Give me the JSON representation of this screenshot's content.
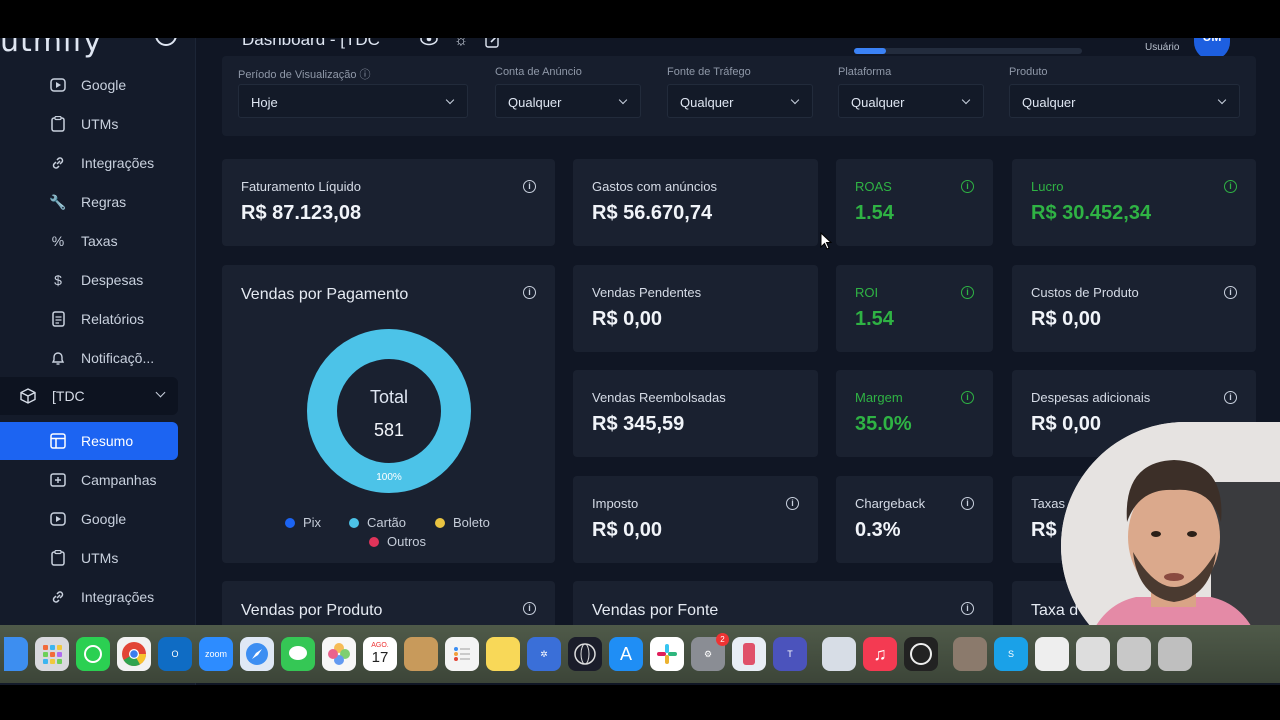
{
  "brand": {
    "name": "utmify"
  },
  "header": {
    "title": "Dashboard - [TDC",
    "progress": 0.14,
    "user_label": "Usuário",
    "avatar_initials": "UM"
  },
  "sidebar": {
    "top_items": [
      {
        "label": "Google",
        "icon": "youtube-icon"
      },
      {
        "label": "UTMs",
        "icon": "clipboard-icon"
      },
      {
        "label": "Integrações",
        "icon": "link-icon"
      },
      {
        "label": "Regras",
        "icon": "wrench-icon"
      },
      {
        "label": "Taxas",
        "icon": "percent-icon"
      },
      {
        "label": "Despesas",
        "icon": "dollar-icon"
      },
      {
        "label": "Relatórios",
        "icon": "report-icon"
      },
      {
        "label": "Notificaçõ...",
        "icon": "bell-icon"
      }
    ],
    "group": {
      "label": "[TDC",
      "icon": "box-icon"
    },
    "group_items": [
      {
        "label": "Resumo",
        "icon": "layout-icon",
        "active": true
      },
      {
        "label": "Campanhas",
        "icon": "campaign-icon"
      },
      {
        "label": "Google",
        "icon": "youtube-icon"
      },
      {
        "label": "UTMs",
        "icon": "clipboard-icon"
      },
      {
        "label": "Integrações",
        "icon": "link-icon"
      }
    ]
  },
  "filters": [
    {
      "label": "Período de Visualização",
      "value": "Hoje"
    },
    {
      "label": "Conta de Anúncio",
      "value": "Qualquer"
    },
    {
      "label": "Fonte de Tráfego",
      "value": "Qualquer"
    },
    {
      "label": "Plataforma",
      "value": "Qualquer"
    },
    {
      "label": "Produto",
      "value": "Qualquer"
    }
  ],
  "cards": {
    "faturamento": {
      "label": "Faturamento Líquido",
      "value": "R$ 87.123,08"
    },
    "gastos": {
      "label": "Gastos com anúncios",
      "value": "R$ 56.670,74"
    },
    "roas": {
      "label": "ROAS",
      "value": "1.54"
    },
    "lucro": {
      "label": "Lucro",
      "value": "R$ 30.452,34"
    },
    "pendentes": {
      "label": "Vendas Pendentes",
      "value": "R$ 0,00"
    },
    "roi": {
      "label": "ROI",
      "value": "1.54"
    },
    "custos": {
      "label": "Custos de Produto",
      "value": "R$ 0,00"
    },
    "reembolsadas": {
      "label": "Vendas Reembolsadas",
      "value": "R$ 345,59"
    },
    "margem": {
      "label": "Margem",
      "value": "35.0%"
    },
    "despesas": {
      "label": "Despesas adicionais",
      "value": "R$ 0,00"
    },
    "imposto": {
      "label": "Imposto",
      "value": "R$ 0,00"
    },
    "chargeback": {
      "label": "Chargeback",
      "value": "0.3%"
    },
    "taxas": {
      "label": "Taxas",
      "value": "R$"
    }
  },
  "payment_chart": {
    "title": "Vendas por Pagamento",
    "center_label": "Total",
    "center_value": "581",
    "slice_label": "100%",
    "legend": [
      {
        "label": "Pix",
        "color": "#1c64f2"
      },
      {
        "label": "Cartão",
        "color": "#4cc3e8"
      },
      {
        "label": "Boleto",
        "color": "#e8c341"
      },
      {
        "label": "Outros",
        "color": "#e0345a"
      }
    ]
  },
  "chart_data": {
    "type": "pie",
    "title": "Vendas por Pagamento",
    "categories": [
      "Pix",
      "Cartão",
      "Boleto",
      "Outros"
    ],
    "values": [
      0,
      100,
      0,
      0
    ],
    "total": 581
  },
  "bottom_cards": {
    "produto": "Vendas por Produto",
    "fonte": "Vendas por Fonte",
    "taxa": "Taxa d"
  },
  "dock": {
    "calendar_month": "AGO.",
    "calendar_day": "17",
    "zoom_label": "zoom",
    "badge": "2"
  }
}
